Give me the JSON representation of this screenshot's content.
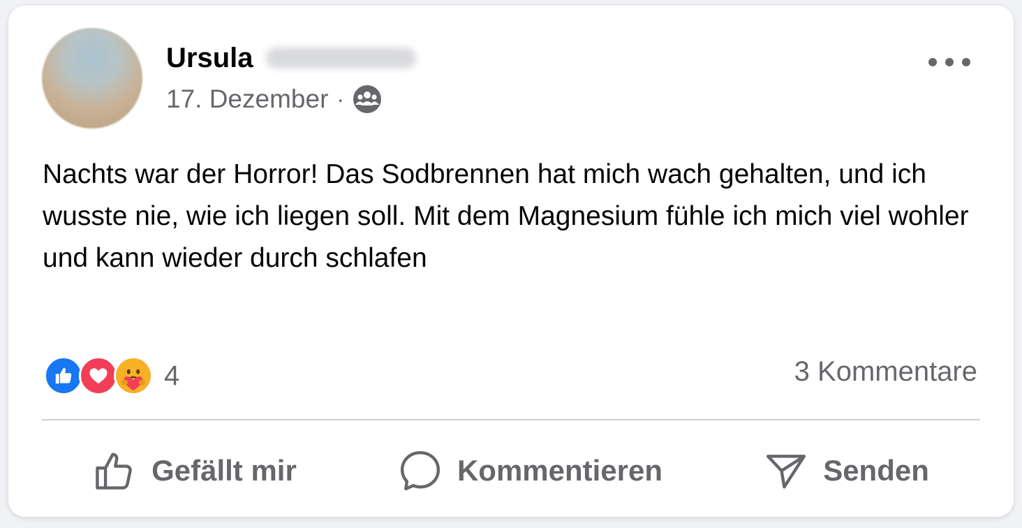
{
  "post": {
    "author_name": "Ursula",
    "date": "17. Dezember",
    "separator": "·",
    "audience_icon": "friends-icon",
    "text": "Nachts war der Horror! Das Sodbrennen hat mich wach gehalten, und ich wusste nie, wie ich liegen soll. Mit dem Magnesium fühle ich mich viel wohler und kann wieder durch schlafen"
  },
  "reactions": {
    "types": [
      "like-icon",
      "love-icon",
      "care-icon"
    ],
    "count": "4"
  },
  "comments": {
    "count_label": "3 Kommentare"
  },
  "actions": {
    "like_label": "Gefällt mir",
    "comment_label": "Kommentieren",
    "send_label": "Senden"
  },
  "colors": {
    "like": "#1877f2",
    "love": "#f33e58",
    "care": "#f7b125",
    "secondary_text": "#65676b"
  }
}
